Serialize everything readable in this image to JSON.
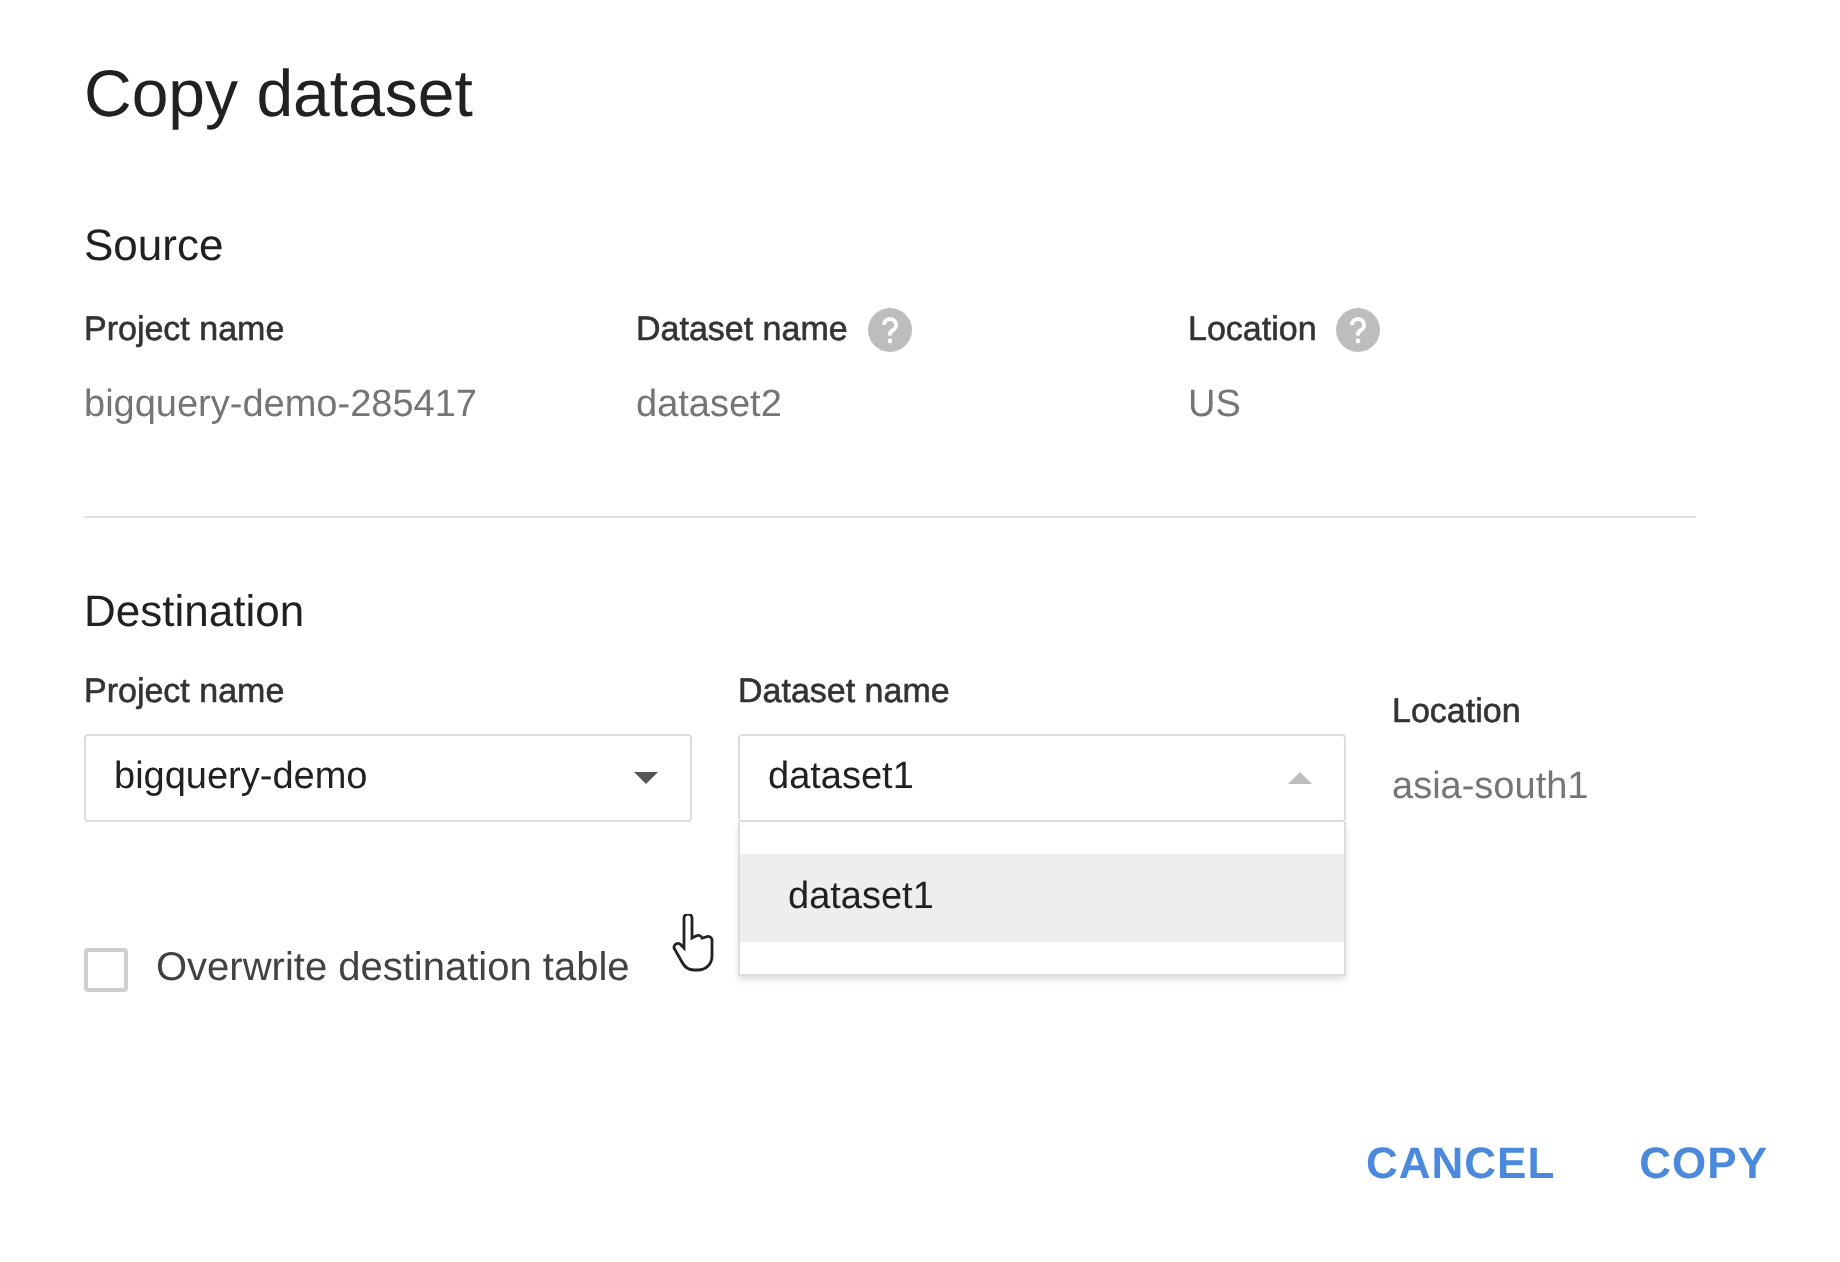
{
  "dialog": {
    "title": "Copy dataset"
  },
  "source": {
    "heading": "Source",
    "fields": [
      {
        "label": "Project name",
        "value": "bigquery-demo-285417",
        "help": false
      },
      {
        "label": "Dataset name",
        "value": "dataset2",
        "help": true
      },
      {
        "label": "Location",
        "value": "US",
        "help": true
      }
    ]
  },
  "destination": {
    "heading": "Destination",
    "selects": [
      {
        "label": "Project name",
        "value": "bigquery-demo",
        "expanded": false
      },
      {
        "label": "Dataset name",
        "value": "dataset1",
        "expanded": true,
        "options": [
          {
            "label": "dataset1",
            "selected": true
          }
        ]
      }
    ],
    "location": {
      "label": "Location",
      "value": "asia-south1"
    }
  },
  "overwrite": {
    "label": "Overwrite destination table",
    "checked": false
  },
  "buttons": [
    "CANCEL",
    "COPY"
  ]
}
